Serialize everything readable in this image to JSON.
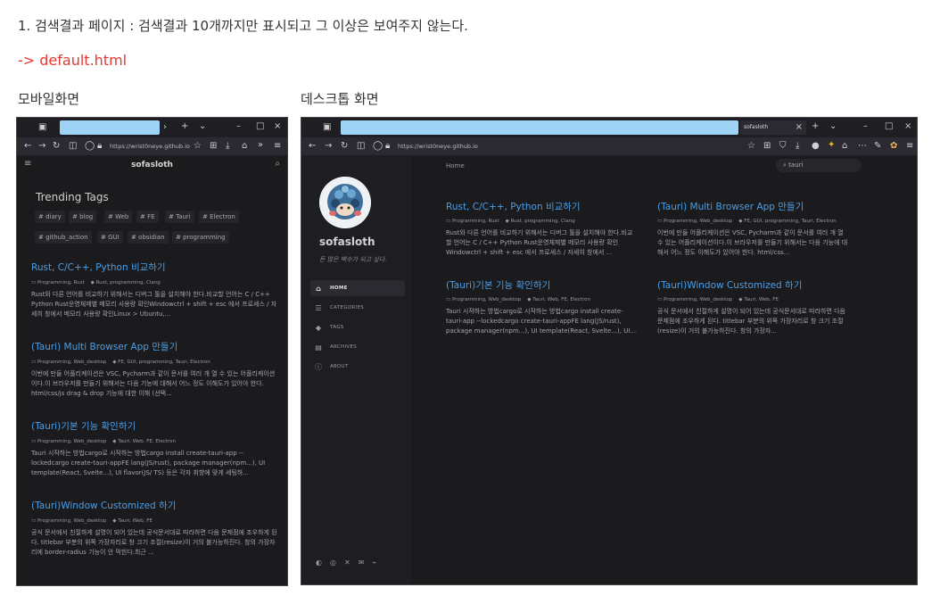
{
  "notes": {
    "line1": "1. 검색결과 페이지 : 검색결과 10개까지만 표시되고 그 이상은 보여주지 않는다.",
    "line2": "-> default.html",
    "mobile_caption": "모바일화면",
    "desktop_caption": "데스크톱 화면"
  },
  "browser": {
    "url": "https://wrist0neye.github.io",
    "desktop_tab_title": "sofasloth"
  },
  "site": {
    "title": "sofasloth",
    "subtitle": "돈 많은 백수가 되고 싶다.",
    "trending_title": "Trending Tags",
    "tags": [
      "# diary",
      "# blog",
      "# Web",
      "# FE",
      "# Tauri",
      "# Electron",
      "# github_action",
      "# GUI",
      "# obsidian",
      "# programming"
    ],
    "nav": [
      "HOME",
      "CATEGORIES",
      "TAGS",
      "ARCHIVES",
      "ABOUT"
    ],
    "breadcrumb": "Home",
    "search_value": "tauri"
  },
  "posts": [
    {
      "title": "Rust, C/C++, Python 비교하기",
      "category": "Programming, Rust",
      "tags": "Rust, programming, Clang",
      "excerpt_mobile": "Rust와 다른 언어를 비교하기 위해서는 디버그 툴을 설치해야 한다.비교할 언어는 C / C++ Python Rust운영체제별 메모리 사용량 확인Windowctrl + shift + esc 에서 프로세스 / 자세히 창에서 메모리 사용량 확인Linux > Ubuntu,...",
      "excerpt_desktop": "Rust와 다른 언어를 비교하기 위해서는 디버그 툴을 설치해야 한다.비교할 언어는 C / C++ Python Rust운영체제별 메모리 사용량 확인Windowctrl + shift + esc 에서 프로세스 / 자세히 창에서 ..."
    },
    {
      "title": "(Tauri) Multi Browser App 만들기",
      "category": "Programming, Web_desktop",
      "tags": "FE, GUI, programming, Tauri, Electron",
      "excerpt_mobile": "이번에 만들 어플리케이션은 VSC, Pycharm과 같이 문서를 여러 개 열 수 있는 어플리케이션이다.이 브라우저를 만들기 위해서는 다음 기능에 대해서 어느 정도 이해도가 있어야 한다. html/css/js drag & drop 기능에 대한 이해 (선택...",
      "excerpt_desktop": "이번에 만들 어플리케이션은 VSC, Pycharm과 같이 문서를 여러 개 열 수 있는 어플리케이션이다.이 브라우저를 만들기 위해서는 다음 기능에 대해서 어느 정도 이해도가 있어야 한다. html/css..."
    },
    {
      "title": "(Tauri)기본 기능 확인하기",
      "category": "Programming, Web_desktop",
      "tags": "Tauri, Web, FE, Electron",
      "excerpt_mobile": "Tauri 시작하는 방법cargo로 시작하는 방법cargo install create-tauri-app --lockedcargo create-tauri-appFE lang(JS/rust), package manager(npm...), UI template(React, Svelte...), UI flavor(JS/ TS) 등은 각자 취향에 맞게 세팅하...",
      "excerpt_desktop": "Tauri 시작하는 방법cargo로 시작하는 방법cargo install create-tauri-app --lockedcargo create-tauri-appFE lang(JS/rust), package manager(npm...), UI template(React, Svelte...), UI..."
    },
    {
      "title": "(Tauri)Window Customized 하기",
      "category": "Programming, Web_desktop",
      "tags": "Tauri, Web, FE",
      "excerpt_mobile": "공식 문서에서 친절하게 설명이 되어 있는데 공식문서대로 따라하면 다음 문제점에 조우하게 된다. titlebar 부분의 위쪽 가장자리로 창 크기 조절(resize)이 거의 불가능하진다. 창의 가장자리에 border-radius 기능이 안 먹힌다.최근 ...",
      "excerpt_desktop": "공식 문서에서 친절하게 설명이 되어 있는데 공식문서대로 따라하면 다음 문제점에 조우하게 된다. titlebar 부분의 위쪽 가장자리로 창 크기 조절(resize)이 거의 불가능하진다. 창의 가장자..."
    }
  ]
}
